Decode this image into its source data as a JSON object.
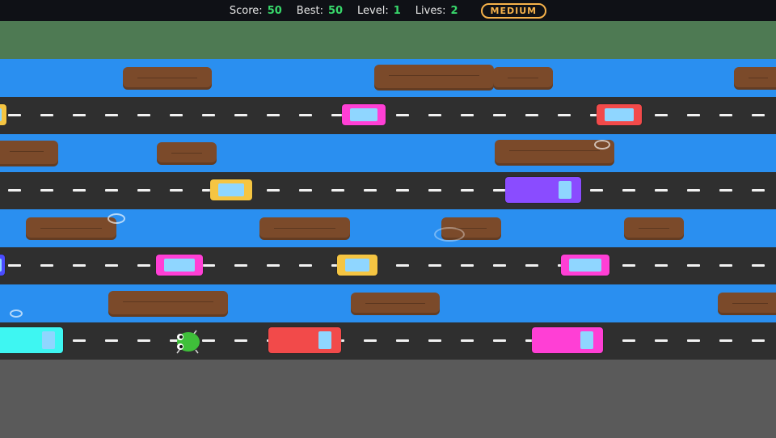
{
  "hud": {
    "score_label": "Score:",
    "score_value": "50",
    "best_label": "Best:",
    "best_value": "50",
    "level_label": "Level:",
    "level_value": "1",
    "lives_label": "Lives:",
    "lives_value": "2",
    "difficulty": "MEDIUM"
  },
  "colors": {
    "goal_grass": "#4e7a53",
    "river": "#2a8ff0",
    "road": "#2f2f2f",
    "start_area": "#5a5a5a",
    "log": "#7b4a2a",
    "frog": "#3fbf3a",
    "hud_value": "#38d86b",
    "difficulty_badge": "#f6b24a"
  },
  "icons": {
    "frog": "frog-sprite"
  }
}
